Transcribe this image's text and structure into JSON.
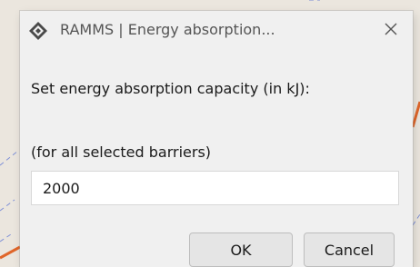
{
  "window": {
    "title": "RAMMS | Energy absorption...",
    "app_icon": "ramms-diamond-icon",
    "close_icon": "close-icon"
  },
  "form": {
    "prompt": "Set energy absorption capacity (in kJ):",
    "note": "(for all selected barriers)",
    "value": "2000"
  },
  "buttons": {
    "ok_label": "OK",
    "cancel_label": "Cancel"
  },
  "colors": {
    "dialog_bg": "#f0f0f0",
    "backdrop": "#ebe6de",
    "backdrop_line_orange": "#e0662a",
    "backdrop_line_blue": "#7d8fd6"
  }
}
